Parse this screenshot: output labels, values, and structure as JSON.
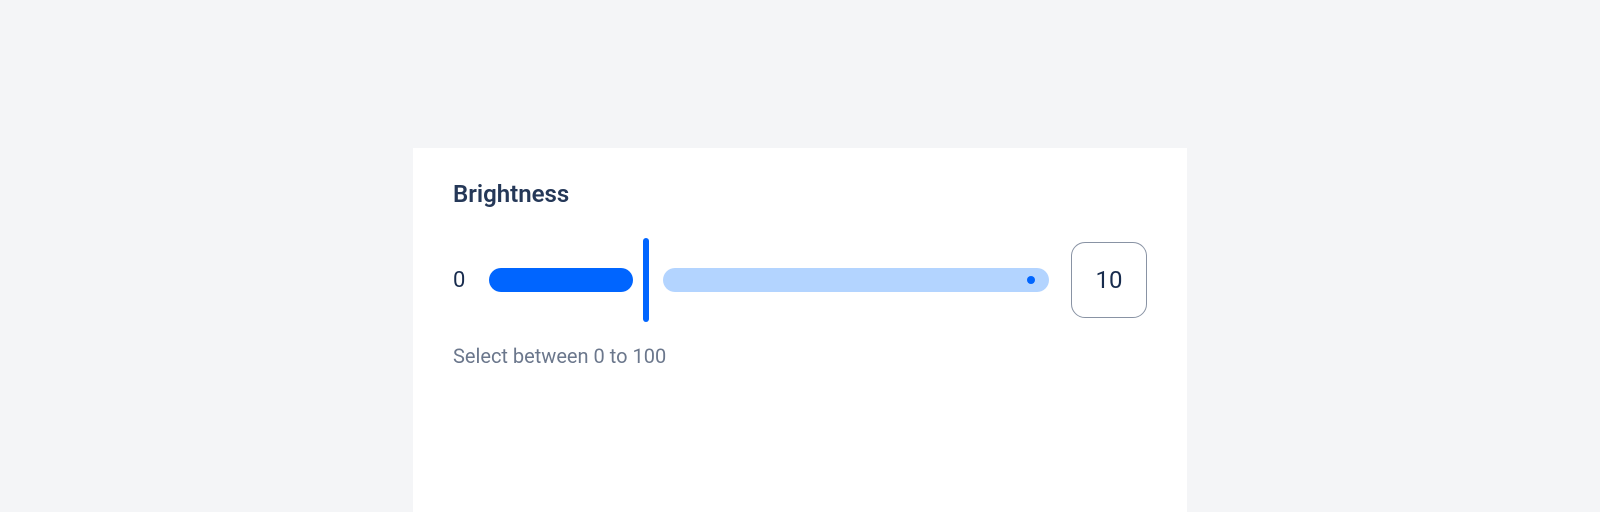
{
  "slider": {
    "label": "Brightness",
    "min_label": "0",
    "value": "10",
    "help_text": "Select between 0 to 100"
  }
}
